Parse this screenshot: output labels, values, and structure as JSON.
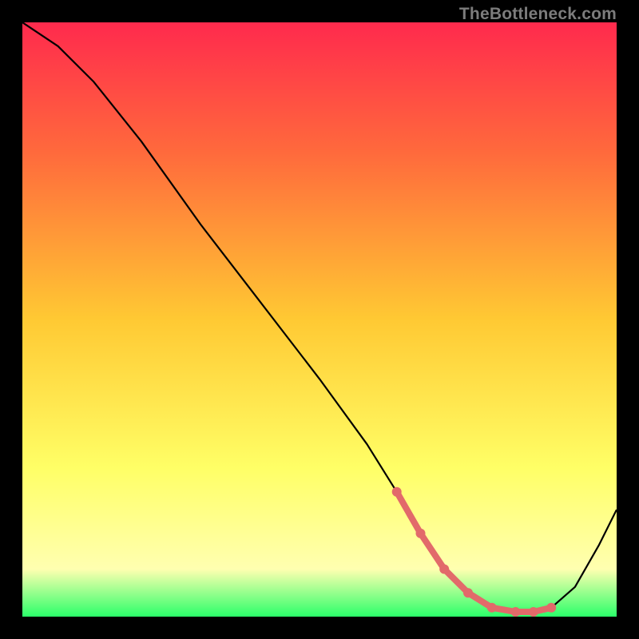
{
  "watermark": "TheBottleneck.com",
  "colors": {
    "bg": "#000000",
    "grad_top": "#ff2a4d",
    "grad_upper": "#ff6a3c",
    "grad_mid": "#ffc933",
    "grad_lower": "#ffff66",
    "grad_yellow_soft": "#ffffb0",
    "grad_bottom": "#2bff6a",
    "curve": "#000000",
    "highlight": "#e26a6a"
  },
  "chart_data": {
    "type": "line",
    "title": "",
    "xlabel": "",
    "ylabel": "",
    "xlim": [
      0,
      100
    ],
    "ylim": [
      0,
      100
    ],
    "series": [
      {
        "name": "bottleneck-curve",
        "x": [
          0,
          6,
          12,
          20,
          30,
          40,
          50,
          58,
          63,
          67,
          71,
          75,
          79,
          83,
          86,
          89,
          93,
          97,
          100
        ],
        "y": [
          100,
          96,
          90,
          80,
          66,
          53,
          40,
          29,
          21,
          14,
          8,
          4,
          1.5,
          0.8,
          0.8,
          1.5,
          5,
          12,
          18
        ]
      }
    ],
    "highlight_region": {
      "name": "optimal-range",
      "x": [
        63,
        67,
        71,
        75,
        79,
        83,
        86,
        89
      ],
      "y": [
        21,
        14,
        8,
        4,
        1.5,
        0.8,
        0.8,
        1.5
      ]
    }
  }
}
